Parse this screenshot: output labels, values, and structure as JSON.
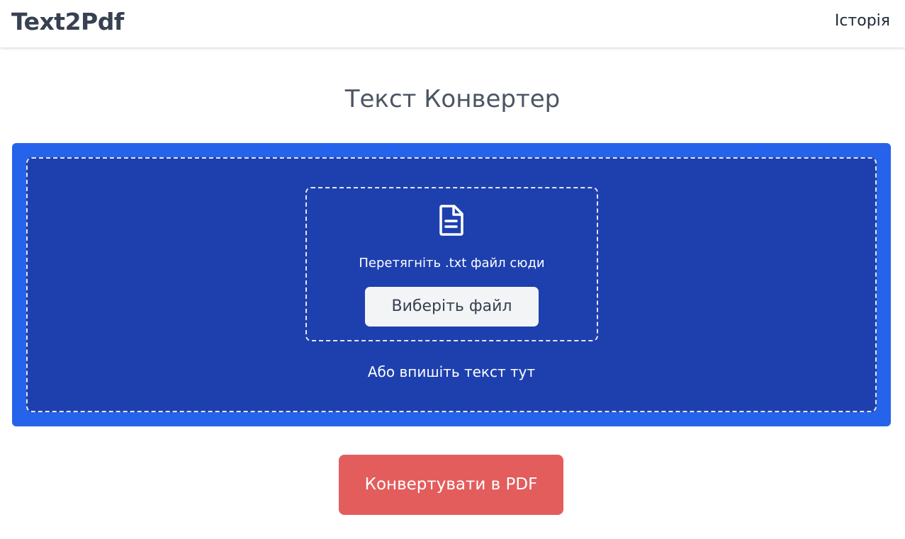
{
  "header": {
    "brand": "Text2Pdf",
    "nav": {
      "history_label": "Історія"
    }
  },
  "main": {
    "title": "Текст Конвертер",
    "upload": {
      "icon": "file-text-icon",
      "drop_text": "Перетягніть .txt файл сюди",
      "choose_file_label": "Виберіть файл",
      "alt_text": "Або впишіть текст тут"
    },
    "convert_label": "Конвертувати в PDF"
  },
  "colors": {
    "outer_panel": "#2563eb",
    "inner_panel": "#1e40af",
    "convert_button": "#e35d5d",
    "text_dark": "#374151"
  }
}
